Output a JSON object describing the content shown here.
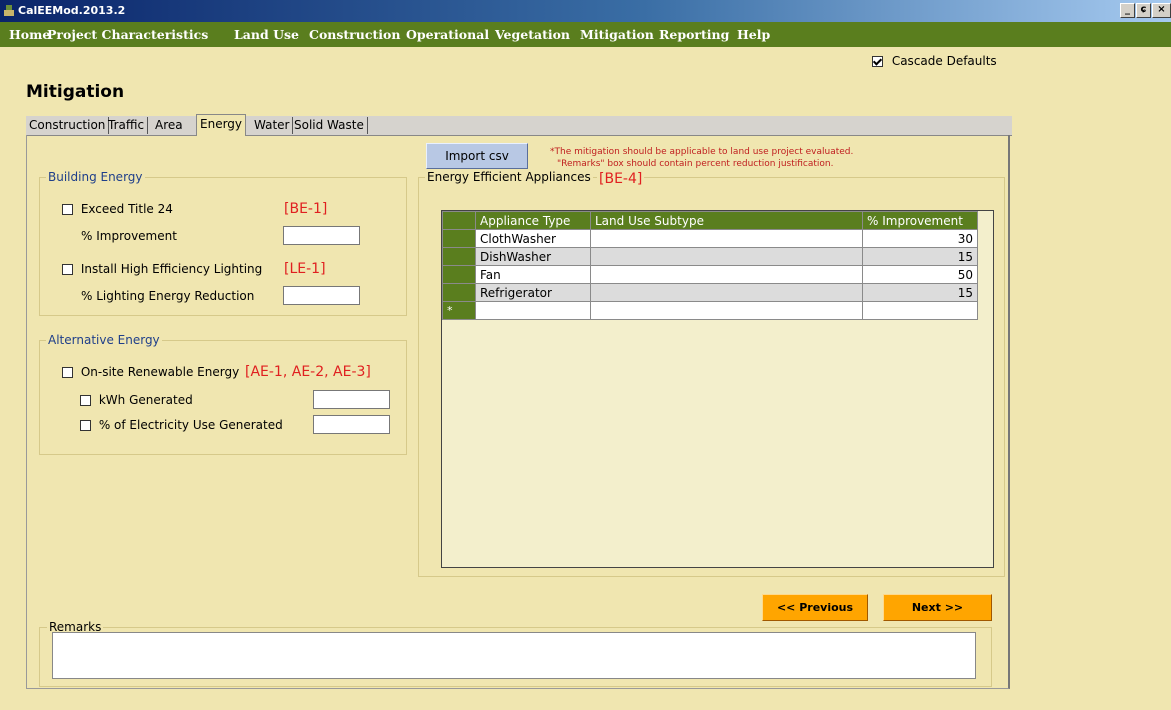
{
  "window": {
    "title": "CalEEMod.2013.2",
    "controls": [
      "_",
      "ɕ",
      "×"
    ]
  },
  "menu": [
    "Home",
    "Project Characteristics",
    "Land Use",
    "Construction",
    "Operational",
    "Vegetation",
    "Mitigation",
    "Reporting",
    "Help"
  ],
  "cascade": {
    "label": "Cascade Defaults",
    "checked": true
  },
  "page_title": "Mitigation",
  "tabs": [
    "Construction",
    "Traffic",
    "Area",
    "Energy",
    "Water",
    "Solid Waste"
  ],
  "active_tab": "Energy",
  "import_button": "Import csv",
  "notes": [
    "*The mitigation should be applicable to land use project evaluated.",
    "\"Remarks\" box should contain percent reduction justification."
  ],
  "building_energy": {
    "title": "Building Energy",
    "exceed_title24": {
      "label": "Exceed Title 24",
      "tag": "[BE-1]",
      "checked": false
    },
    "improvement": {
      "label": "% Improvement",
      "value": ""
    },
    "lighting": {
      "label": "Install High Efficiency Lighting",
      "tag": "[LE-1]",
      "checked": false
    },
    "lighting_reduction": {
      "label": "% Lighting Energy Reduction",
      "value": ""
    }
  },
  "alternative_energy": {
    "title": "Alternative Energy",
    "renewable": {
      "label": "On-site Renewable Energy",
      "tag": "[AE-1, AE-2, AE-3]",
      "checked": false
    },
    "kwh": {
      "label": "kWh Generated",
      "value": "",
      "checked": false
    },
    "percent": {
      "label": "% of Electricity Use Generated",
      "value": "",
      "checked": false
    }
  },
  "appliances": {
    "title": "Energy Efficient Appliances",
    "tag": "[BE-4]",
    "columns": [
      "Appliance Type",
      "Land Use Subtype",
      "% Improvement"
    ],
    "rows": [
      {
        "type": "ClothWasher",
        "subtype": "",
        "improvement": "30"
      },
      {
        "type": "DishWasher",
        "subtype": "",
        "improvement": "15"
      },
      {
        "type": "Fan",
        "subtype": "",
        "improvement": "50"
      },
      {
        "type": "Refrigerator",
        "subtype": "",
        "improvement": "15"
      }
    ],
    "new_row_marker": "*"
  },
  "nav": {
    "previous": "<< Previous",
    "next": "Next >>"
  },
  "remarks": {
    "label": "Remarks",
    "value": ""
  },
  "colors": {
    "menu_bg": "#5a7e1e",
    "page_bg": "#f0e6b0",
    "nav_button": "#ffa500",
    "tag_red": "#e02020"
  }
}
